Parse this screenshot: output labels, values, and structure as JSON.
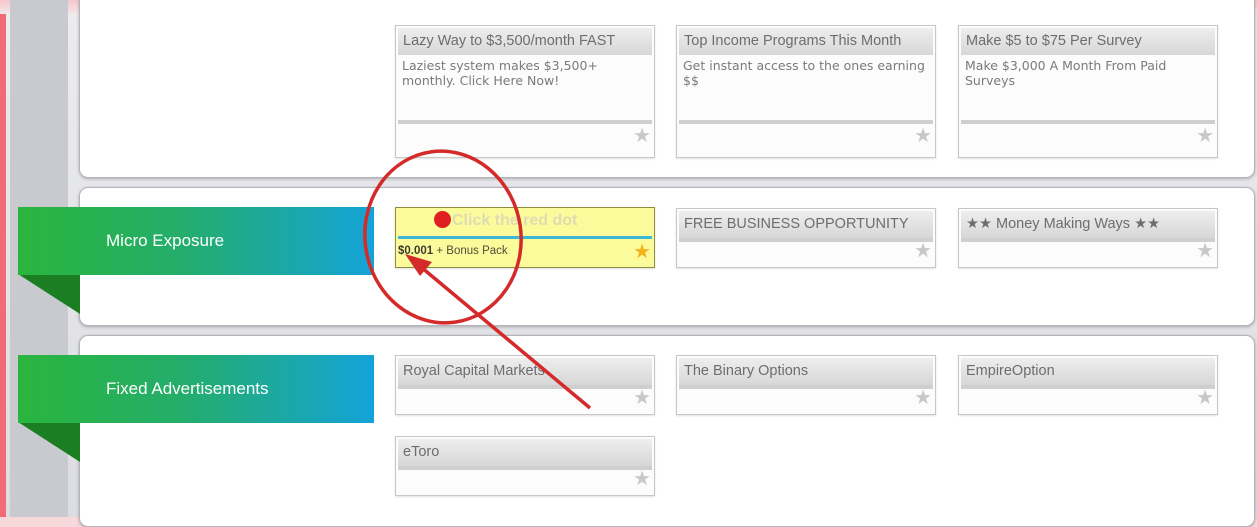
{
  "top_ads": [
    {
      "title": "Lazy Way to $3,500/month FAST",
      "desc": "Laziest system makes $3,500+ monthly. Click Here Now!"
    },
    {
      "title": "Top Income Programs This Month",
      "desc": "Get instant access to the ones earning $$"
    },
    {
      "title": "Make $5 to $75 Per Survey",
      "desc": "Make $3,000 A Month From Paid Surveys"
    }
  ],
  "micro": {
    "ribbon_label": "Micro Exposure",
    "highlight": {
      "title": "Click the red dot",
      "price": "$0.001",
      "price_suffix": "+ Bonus Pack"
    },
    "ads": [
      {
        "title": "FREE BUSINESS OPPORTUNITY"
      },
      {
        "title": "★★ Money Making Ways ★★"
      }
    ]
  },
  "fixed": {
    "ribbon_label": "Fixed Advertisements",
    "ads": [
      {
        "title": "Royal Capital Markets"
      },
      {
        "title": "The Binary Options"
      },
      {
        "title": "EmpireOption"
      },
      {
        "title": "eToro"
      }
    ]
  },
  "icons": {
    "star": "star-icon",
    "annotation": "red-circle-arrow-annotation"
  },
  "colors": {
    "ribbon_start": "#2ab53d",
    "ribbon_end": "#14a3d9",
    "annotation": "#d42a2a",
    "highlight_bg": "#fbfb9c"
  }
}
